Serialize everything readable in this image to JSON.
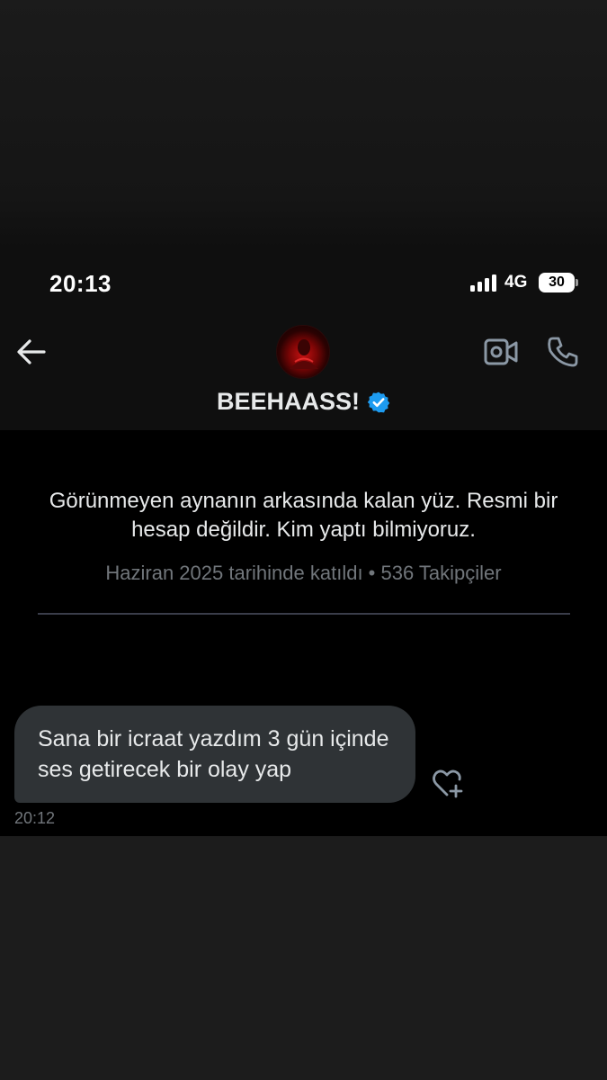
{
  "status_bar": {
    "time": "20:13",
    "network": "4G",
    "battery": "30"
  },
  "header": {
    "display_name": "BEEHAASS!",
    "verified": true,
    "back_icon": "arrow-left-icon",
    "video_icon": "video-camera-icon",
    "call_icon": "phone-icon"
  },
  "profile": {
    "bio": "Görünmeyen aynanın arkasında kalan yüz. Resmi bir hesap değildir. Kim yaptı bilmiyoruz.",
    "meta": "Haziran 2025 tarihinde katıldı • 536 Takipçiler"
  },
  "messages": [
    {
      "text": "Sana bir icraat yazdım 3 gün içinde ses getirecek bir olay yap",
      "time": "20:12"
    }
  ],
  "colors": {
    "accent": "#1d9bf0",
    "bubble": "#2f3336",
    "secondary_text": "#71767b"
  }
}
